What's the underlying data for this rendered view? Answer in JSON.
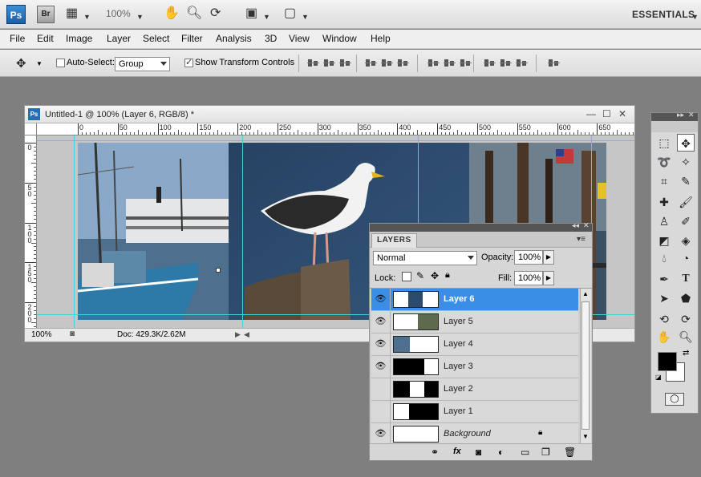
{
  "app": {
    "logo": "Ps",
    "bridge_logo": "Br",
    "zoom_level": "100%",
    "workspace": "ESSENTIALS"
  },
  "menu": [
    "File",
    "Edit",
    "Image",
    "Layer",
    "Select",
    "Filter",
    "Analysis",
    "3D",
    "View",
    "Window",
    "Help"
  ],
  "options": {
    "auto_select_label": "Auto-Select:",
    "auto_select_checked": false,
    "auto_select_value": "Group",
    "show_transform_label": "Show Transform Controls",
    "show_transform_checked": true
  },
  "document": {
    "title": "Untitled-1 @ 100% (Layer 6, RGB/8) *",
    "ruler_h": [
      "0",
      "50",
      "100",
      "150",
      "200",
      "250",
      "300",
      "350",
      "400",
      "450",
      "500",
      "550",
      "600",
      "650"
    ],
    "ruler_v": [
      "0",
      "5\n0",
      "1\n0\n0",
      "1\n5\n0",
      "2\n0\n0"
    ],
    "status_zoom": "100%",
    "status_doc": "Doc: 429.3K/2.62M"
  },
  "layers_panel": {
    "tab": "LAYERS",
    "blend_mode": "Normal",
    "opacity_label": "Opacity:",
    "opacity": "100%",
    "lock_label": "Lock:",
    "fill_label": "Fill:",
    "fill": "100%",
    "layers": [
      {
        "name": "Layer 6",
        "visible": true,
        "active": true
      },
      {
        "name": "Layer 5",
        "visible": true,
        "active": false
      },
      {
        "name": "Layer 4",
        "visible": true,
        "active": false
      },
      {
        "name": "Layer 3",
        "visible": true,
        "active": false
      },
      {
        "name": "Layer 2",
        "visible": false,
        "active": false
      },
      {
        "name": "Layer 1",
        "visible": false,
        "active": false
      },
      {
        "name": "Background",
        "visible": true,
        "active": false,
        "locked": true
      }
    ],
    "footer_icons": [
      "link-icon",
      "fx-icon",
      "mask-icon",
      "adjustment-icon",
      "folder-icon",
      "new-layer-icon",
      "trash-icon"
    ]
  },
  "colors": {
    "accent": "#3a8ee6",
    "guide": "#3fd3d8",
    "foreground": "#000000",
    "background": "#ffffff"
  }
}
